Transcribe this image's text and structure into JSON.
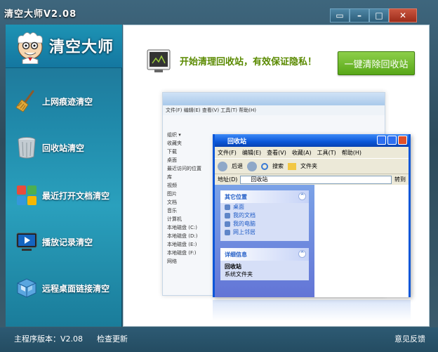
{
  "window": {
    "title": "清空大师V2.08",
    "controls": {
      "menu": "▭",
      "minimize": "–",
      "maximize": "□",
      "close": "✕"
    }
  },
  "sidebar": {
    "logo_text": "清空大师",
    "items": [
      {
        "label": "上网痕迹清空",
        "icon": "broom-icon"
      },
      {
        "label": "回收站清空",
        "icon": "recycle-bin-icon"
      },
      {
        "label": "最近打开文档清空",
        "icon": "documents-icon"
      },
      {
        "label": "播放记录清空",
        "icon": "media-player-icon"
      },
      {
        "label": "远程桌面链接清空",
        "icon": "remote-desktop-icon"
      }
    ]
  },
  "main": {
    "headline": "开始清理回收站，有效保证隐私！",
    "clean_button": "一键清除回收站"
  },
  "illustration": {
    "back_window": {
      "menu": "文件(F)  编辑(E)  查看(V)  工具(T)  帮助(H)",
      "address": "回收站",
      "organize": "组织 ▾",
      "favorites": [
        "收藏夹",
        "下载",
        "桌面",
        "最近访问的位置"
      ],
      "libraries": [
        "库",
        "视频",
        "图片",
        "文档",
        "音乐"
      ],
      "computer": [
        "计算机",
        "本地磁盘 (C:)",
        "本地磁盘 (D:)",
        "本地磁盘 (E:)",
        "本地磁盘 (F:)"
      ],
      "network": "网络"
    },
    "xp_window": {
      "title": "回收站",
      "menu": [
        "文件(F)",
        "编辑(E)",
        "查看(V)",
        "收藏(A)",
        "工具(T)",
        "帮助(H)"
      ],
      "toolbar": {
        "back": "后退",
        "search": "搜索",
        "folders": "文件夹"
      },
      "address_label": "地址(D)",
      "address_value": "回收站",
      "go": "转到",
      "other_places": {
        "header": "其它位置",
        "links": [
          "桌面",
          "我的文档",
          "我的电脑",
          "网上邻居"
        ]
      },
      "details": {
        "header": "详细信息",
        "name": "回收站",
        "type": "系统文件夹"
      }
    }
  },
  "statusbar": {
    "version": "主程序版本：V2.08",
    "check_update": "检查更新",
    "feedback": "意见反馈"
  }
}
